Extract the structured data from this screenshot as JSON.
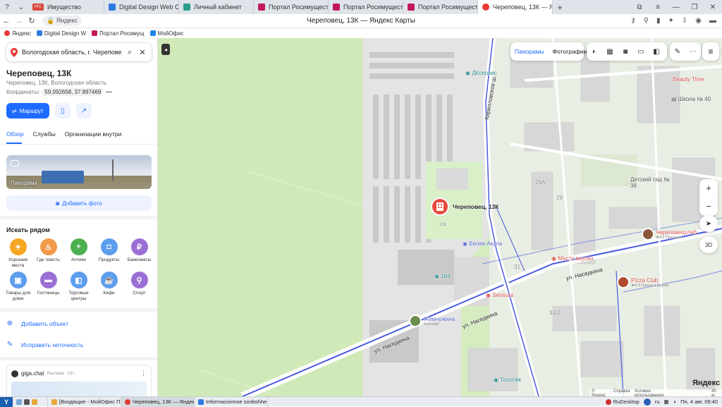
{
  "browser": {
    "tabs": [
      {
        "label": "Имущество",
        "color": "#d84a3a",
        "active": false,
        "badge": "РТС"
      },
      {
        "label": "Digital Design Web Client",
        "color": "#2d7be0",
        "active": false
      },
      {
        "label": "Личный кабинет",
        "color": "#2a9d8f",
        "active": false
      },
      {
        "label": "Портал Росимущества",
        "color": "#c2185b",
        "active": false
      },
      {
        "label": "Портал Росимущества",
        "color": "#c2185b",
        "active": false
      },
      {
        "label": "Портал Росимущества",
        "color": "#c2185b",
        "active": false
      },
      {
        "label": "Череповец, 13К — Янд",
        "color": "#e53935",
        "active": true
      }
    ],
    "domain": "Яндекс",
    "page_title": "Череповец, 13К — Яндекс Карты",
    "bookmarks": [
      {
        "label": "Яндекс",
        "color": "#e53935"
      },
      {
        "label": "Digital Design W",
        "color": "#2d7be0"
      },
      {
        "label": "Портал Росимущ",
        "color": "#c2185b"
      },
      {
        "label": "МойОфис",
        "color": "#1e88e5"
      }
    ]
  },
  "sidebar": {
    "search_value": "Вологодская область, г. Череповец,",
    "place_title": "Череповец, 13К",
    "place_address": "Череповец, 13К, Вологодская область",
    "coords_label": "Координаты:",
    "coords_value": "59.092658, 37.897469",
    "coords_more": "•••",
    "route_label": "Маршрут",
    "tabs": [
      "Обзор",
      "Службы",
      "Организации внутри"
    ],
    "photo_label": "Панорама",
    "add_photo_label": "Добавить фото",
    "nearby_title": "Искать рядом",
    "categories": [
      {
        "label": "Хорошие места",
        "color": "#f5a623",
        "glyph": "✦"
      },
      {
        "label": "Где поесть",
        "color": "#f2994a",
        "glyph": "♨"
      },
      {
        "label": "Аптеки",
        "color": "#4caf50",
        "glyph": "+"
      },
      {
        "label": "Продукты",
        "color": "#5c9ded",
        "glyph": "◘"
      },
      {
        "label": "Банкоматы",
        "color": "#9b6fd6",
        "glyph": "₽"
      },
      {
        "label": "Товары для дома",
        "color": "#5c9ded",
        "glyph": "▣"
      },
      {
        "label": "Гостиницы",
        "color": "#9b6fd6",
        "glyph": "▬"
      },
      {
        "label": "Торговые центры",
        "color": "#5c9ded",
        "glyph": "◧"
      },
      {
        "label": "Кафе",
        "color": "#5c9ded",
        "glyph": "☕"
      },
      {
        "label": "Спорт",
        "color": "#9b6fd6",
        "glyph": "⚲"
      }
    ],
    "add_object_label": "Добавить объект",
    "fix_label": "Исправить неточность",
    "giga_title": "giga.chat",
    "giga_sub": "Реклама · 18+"
  },
  "map": {
    "tools": {
      "panoramas": "Панорамы",
      "photos": "Фотографии"
    },
    "markers": {
      "main": "Череповец, 13К",
      "main_sub": "13К",
      "dk": "ДКсервис",
      "belaya": "Белая Акула",
      "n164": "164",
      "sensora": "Sensora",
      "zhemchuzhina": "Жемчужина",
      "zhemchuzhina_sub": "Бассейн",
      "cherepovets_hleb": "Череповецхлеб",
      "cherepovets_hleb_rating": "★4.2 Пекарня",
      "pizza": "Pizza Club",
      "pizza_rating": "★4.3 Пицца и бургер",
      "mesto": "Место вкусно",
      "school": "Школа № 40",
      "detsad": "Детский сад № 36",
      "beauty": "Beauty Time",
      "topolek": "Тополёк",
      "street1": "ул. Наседкина",
      "street2": "ул. Наседкина",
      "street3": "ул. Наседкина",
      "street_kir": "Кирилловское ш.",
      "house_29a": "29А",
      "house_29b": "29",
      "house_31": "31",
      "house_33": "33/2"
    },
    "zoom_in": "+",
    "zoom_out": "−",
    "three_d": "3D",
    "logo": "Яндекс",
    "footer": [
      "© Яндекс",
      "Справка",
      "Условия использования"
    ],
    "scale": "40 м",
    "accent": "#1e6bff",
    "road_blue": "#4a5be0"
  },
  "taskbar": {
    "items": [
      {
        "label": "[Входящие - МойОфис П...",
        "color": "#e7a93a"
      },
      {
        "label": "Череповец, 13К — Яндек...",
        "color": "#e53935"
      },
      {
        "label": "Informacionnoe soobshhe...",
        "color": "#2d7be0"
      }
    ],
    "rudesktop": "RuDesktop",
    "lang": "ru",
    "clock": "Пн, 4 авг, 09:40"
  }
}
